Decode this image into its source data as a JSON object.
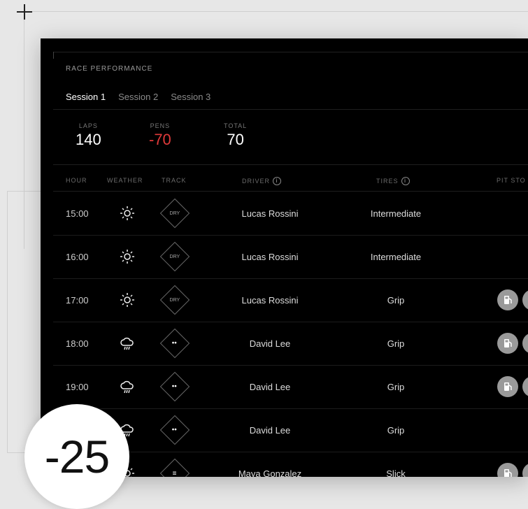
{
  "section_label": "RACE PERFORMANCE",
  "tabs": [
    {
      "label": "Session 1",
      "active": true
    },
    {
      "label": "Session 2",
      "active": false
    },
    {
      "label": "Session 3",
      "active": false
    }
  ],
  "stats": {
    "laps": {
      "label": "LAPS",
      "value": "140"
    },
    "pens": {
      "label": "PENS",
      "value": "-70"
    },
    "total": {
      "label": "TOTAL",
      "value": "70"
    }
  },
  "columns": {
    "hour": "HOUR",
    "weather": "WEATHER",
    "track": "TRACK",
    "driver": "DRIVER",
    "tires": "TIRES",
    "pit": "PIT STO"
  },
  "rows": [
    {
      "hour": "15:00",
      "weather": "sun-icon",
      "track_label": "DRY",
      "track": "dry",
      "driver": "Lucas Rossini",
      "tires": "Intermediate",
      "pits": []
    },
    {
      "hour": "16:00",
      "weather": "sun-icon",
      "track_label": "DRY",
      "track": "dry",
      "driver": "Lucas Rossini",
      "tires": "Intermediate",
      "pits": []
    },
    {
      "hour": "17:00",
      "weather": "sun-icon",
      "track_label": "DRY",
      "track": "dry",
      "driver": "Lucas Rossini",
      "tires": "Grip",
      "pits": [
        "fuel-icon",
        "pit-icon"
      ]
    },
    {
      "hour": "18:00",
      "weather": "rain-cloud-icon",
      "track_label": "",
      "track": "wet",
      "driver": "David Lee",
      "tires": "Grip",
      "pits": [
        "fuel-icon",
        "pit-icon"
      ]
    },
    {
      "hour": "19:00",
      "weather": "rain-cloud-icon",
      "track_label": "",
      "track": "wet",
      "driver": "David Lee",
      "tires": "Grip",
      "pits": [
        "fuel-icon",
        "pit-icon"
      ]
    },
    {
      "hour": "",
      "weather": "rain-cloud-icon",
      "track_label": "",
      "track": "wet",
      "driver": "David Lee",
      "tires": "Grip",
      "pits": []
    },
    {
      "hour": "",
      "weather": "sun-icon",
      "track_label": "",
      "track": "fog",
      "driver": "Maya Gonzalez",
      "tires": "Slick",
      "pits": [
        "fuel-icon",
        "tire-icon"
      ]
    }
  ],
  "badge": "-25",
  "colors": {
    "negative": "#e03a3a",
    "background": "#000000"
  }
}
